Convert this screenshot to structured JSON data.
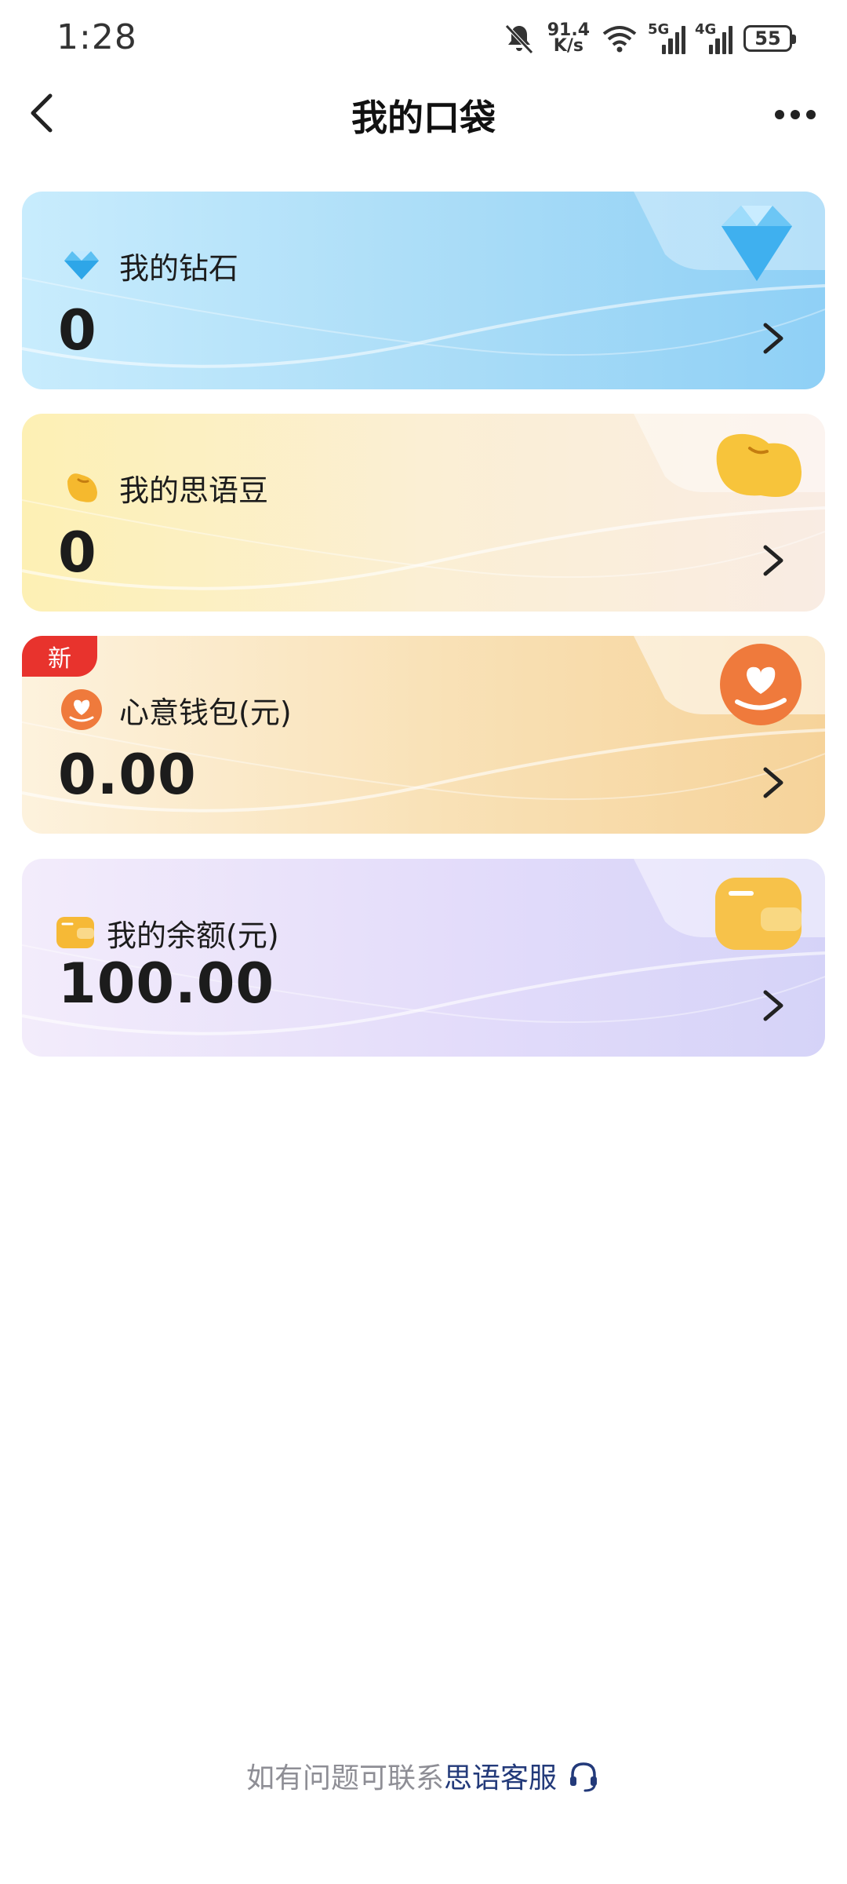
{
  "status_bar": {
    "time": "1:28",
    "net_speed_value": "91.4",
    "net_speed_unit": "K/s",
    "sim1": "5G",
    "sim2": "4G",
    "battery": "55"
  },
  "header": {
    "title": "我的口袋"
  },
  "cards": [
    {
      "label": "我的钻石",
      "value": "0",
      "icon": "diamond-icon"
    },
    {
      "label": "我的思语豆",
      "value": "0",
      "icon": "bean-icon"
    },
    {
      "label": "心意钱包(元)",
      "value": "0.00",
      "icon": "heart-hand-icon",
      "badge": "新"
    },
    {
      "label": "我的余额(元)",
      "value": "100.00",
      "icon": "wallet-icon"
    }
  ],
  "footer": {
    "prefix": "如有问题可联系",
    "link": "思语客服"
  },
  "colors": {
    "badge": "#e8332d",
    "footer_link": "#233a7a",
    "footer_text": "#8e8e95"
  }
}
